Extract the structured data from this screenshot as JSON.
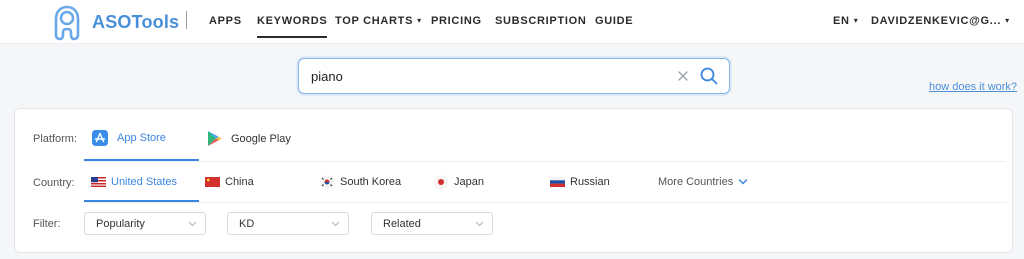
{
  "header": {
    "brand": "ASOTools",
    "nav": {
      "apps": "APPS",
      "keywords": "KEYWORDS",
      "top_charts": "TOP CHARTS",
      "pricing": "PRICING",
      "subscription": "SUBSCRIPTION",
      "guide": "GUIDE"
    },
    "language": "EN",
    "account": "DAVIDZENKEVIC@G..."
  },
  "search": {
    "value": "piano",
    "help_link": "how does it work?"
  },
  "filters": {
    "platform_label": "Platform:",
    "platforms": [
      "App Store",
      "Google Play"
    ],
    "selected_platform": "App Store",
    "country_label": "Country:",
    "countries": [
      "United States",
      "China",
      "South Korea",
      "Japan",
      "Russian"
    ],
    "selected_country": "United States",
    "more_countries": "More Countries",
    "filter_label": "Filter:",
    "selects": [
      "Popularity",
      "KD",
      "Related"
    ]
  },
  "colors": {
    "accent": "#3a86e0",
    "brand": "#4a90d9",
    "nav_text": "#2b2b2b"
  }
}
